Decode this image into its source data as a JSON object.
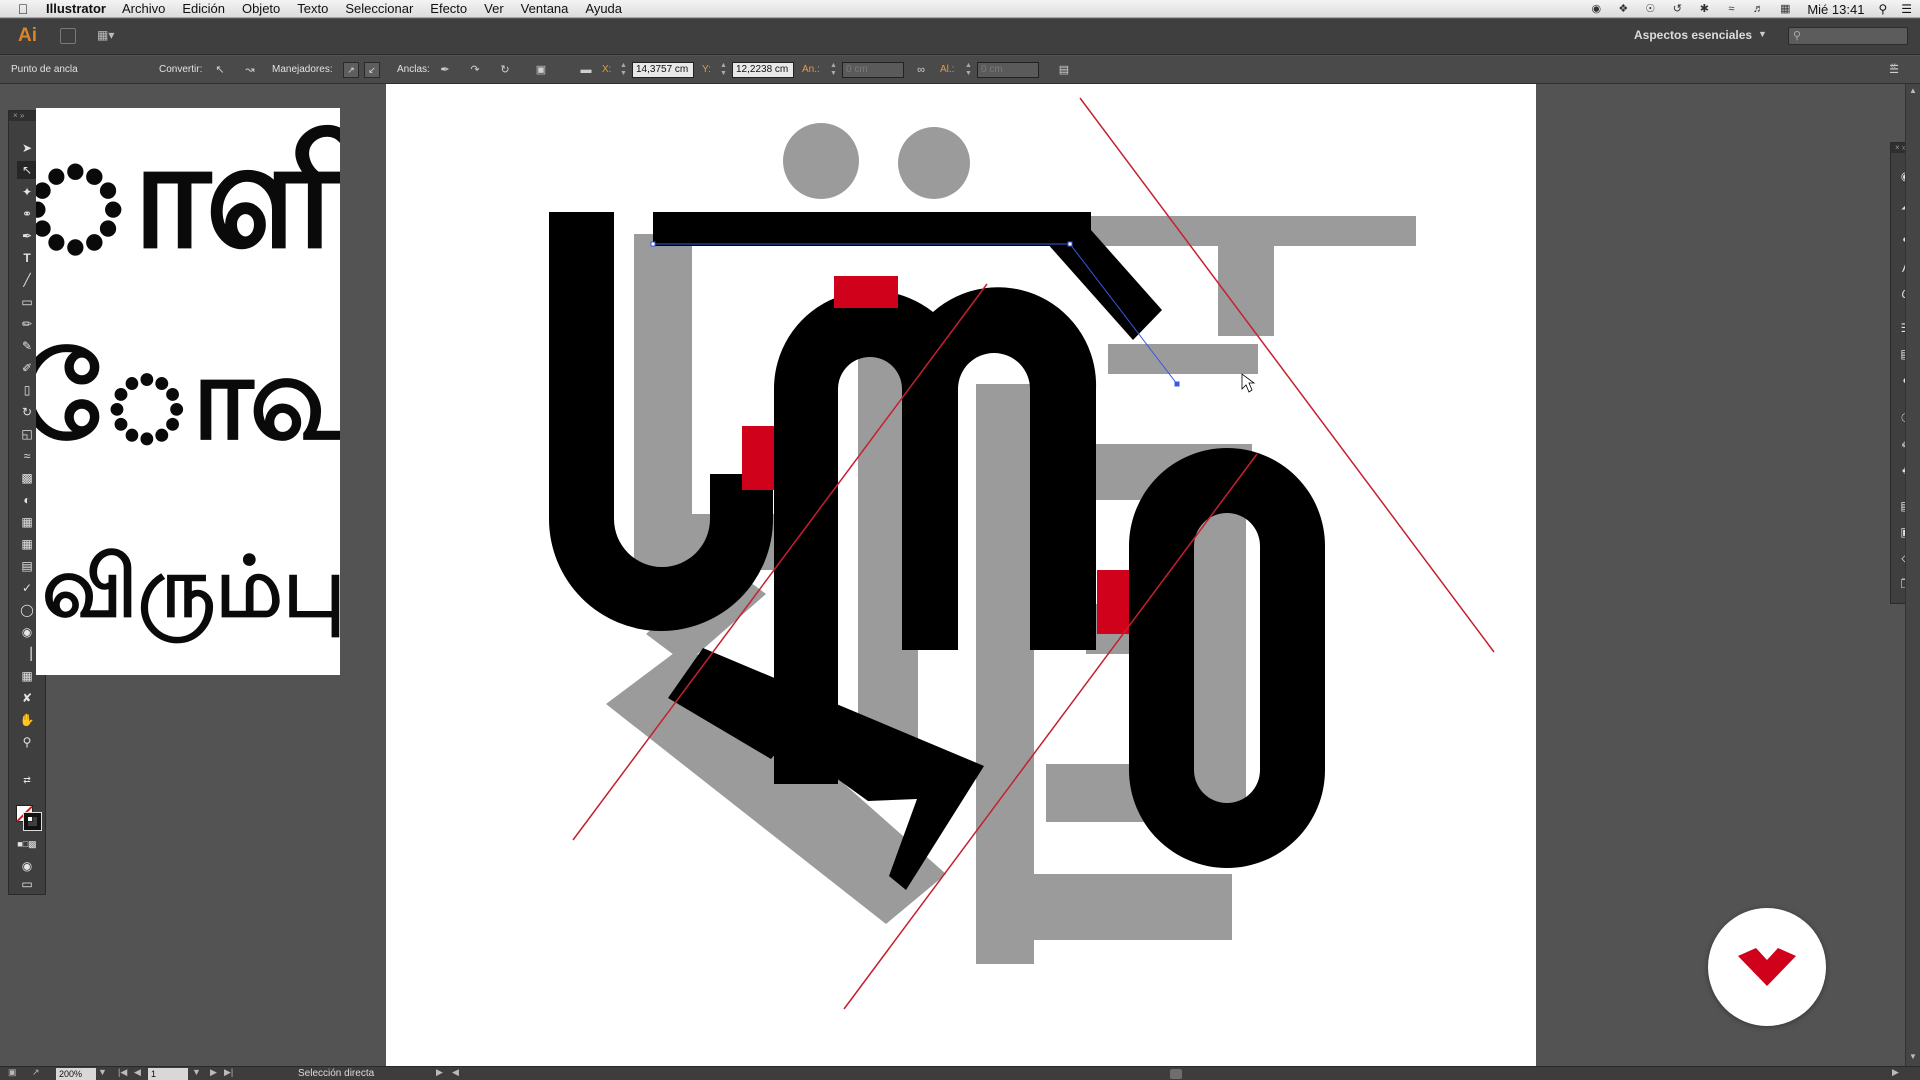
{
  "menubar": {
    "app_name": "Illustrator",
    "items": [
      "Archivo",
      "Edición",
      "Objeto",
      "Texto",
      "Seleccionar",
      "Efecto",
      "Ver",
      "Ventana",
      "Ayuda"
    ],
    "clock": "Mié 13:41"
  },
  "appbar": {
    "logo": "Ai",
    "workspace": "Aspectos esenciales"
  },
  "controlbar": {
    "mode_label": "Punto de ancla",
    "convert_label": "Convertir:",
    "handles_label": "Manejadores:",
    "anchors_label": "Anclas:",
    "x_label": "X:",
    "x_value": "14,3757 cm",
    "y_label": "Y:",
    "y_value": "12,2238 cm",
    "width_label": "An.:",
    "width_value": "0 cm",
    "height_label": "Al.:",
    "height_value": "0 cm"
  },
  "reference": {
    "lines": [
      "ாளி",
      "ோவா",
      "விரும்பு"
    ]
  },
  "statusbar": {
    "zoom": "200%",
    "page": "1",
    "tool": "Selección directa"
  },
  "colors": {
    "accent_red": "#d0021b",
    "guide_red": "#c4212e",
    "shadow_gray": "#9b9b9b",
    "glyph_black": "#000000",
    "selection_blue": "#3a58e0"
  }
}
